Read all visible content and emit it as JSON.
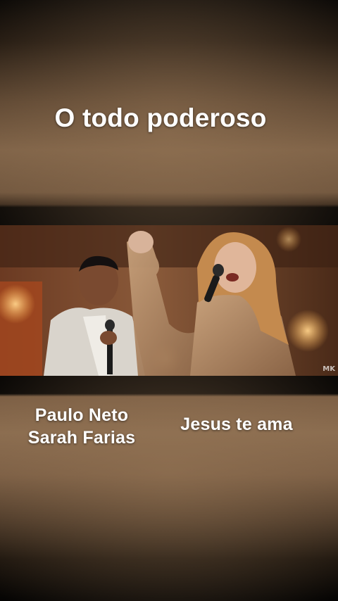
{
  "post": {
    "title": "O todo poderoso",
    "artists": [
      "Paulo Neto",
      "Sarah Farias"
    ],
    "tagline": "Jesus te ama"
  },
  "video": {
    "watermark": "MK"
  },
  "colors": {
    "background_warm": "#7e6247",
    "text": "#ffffff",
    "letterbox": "#000000"
  }
}
